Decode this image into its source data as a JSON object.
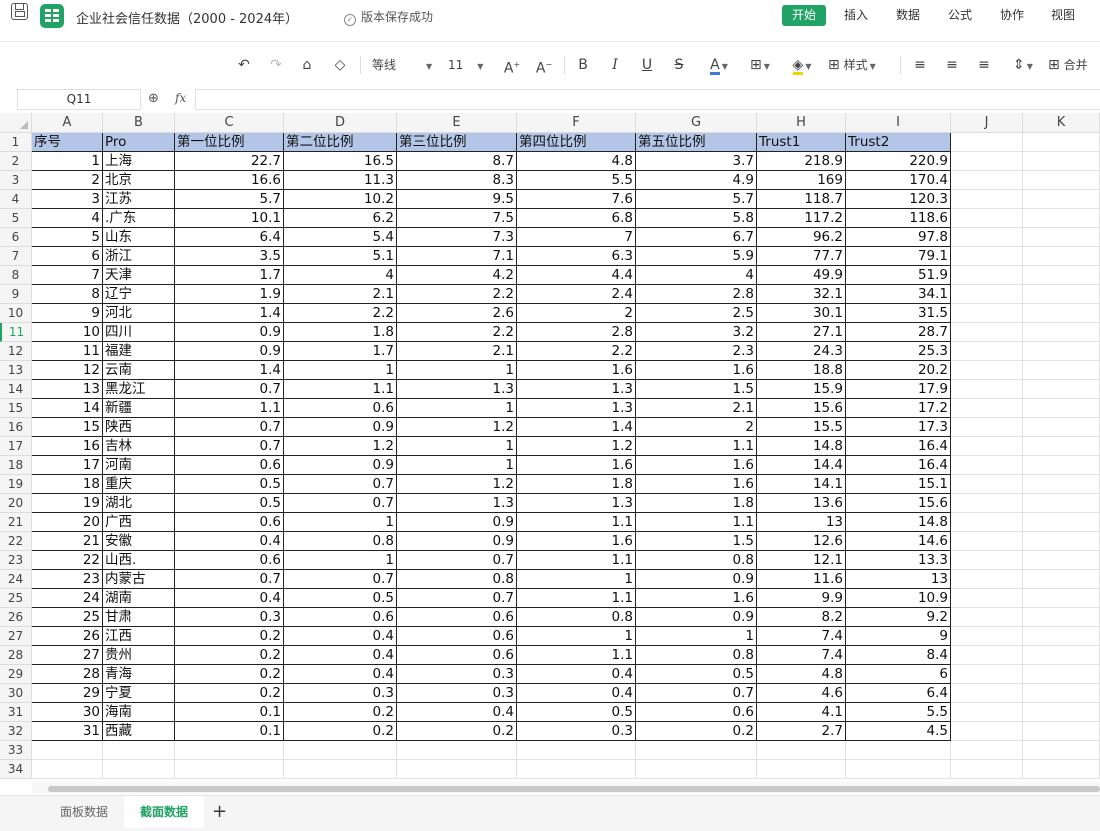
{
  "title": "企业社会信任数据（2000 - 2024年）",
  "save_status": "版本保存成功",
  "menu": [
    "开始",
    "插入",
    "数据",
    "公式",
    "协作",
    "视图"
  ],
  "toolbar": {
    "font_name": "等线",
    "font_size": "11",
    "style_label": "样式",
    "merge_label": "合并"
  },
  "name_box": "Q11",
  "fx_label": "fx",
  "columns": [
    "A",
    "B",
    "C",
    "D",
    "E",
    "F",
    "G",
    "H",
    "I",
    "J",
    "K"
  ],
  "selected_row": 11,
  "row_numbers": [
    1,
    2,
    3,
    4,
    5,
    6,
    7,
    8,
    9,
    10,
    11,
    12,
    13,
    14,
    15,
    16,
    17,
    18,
    19,
    20,
    21,
    22,
    23,
    24,
    25,
    26,
    27,
    28,
    29,
    30,
    31,
    32,
    33,
    34
  ],
  "headers": [
    "序号",
    "Pro",
    "第一位比例",
    "第二位比例",
    "第三位比例",
    "第四位比例",
    "第五位比例",
    "Trust1",
    "Trust2"
  ],
  "rows": [
    [
      "1",
      "上海",
      "22.7",
      "16.5",
      "8.7",
      "4.8",
      "3.7",
      "218.9",
      "220.9"
    ],
    [
      "2",
      "北京",
      "16.6",
      "11.3",
      "8.3",
      "5.5",
      "4.9",
      "169",
      "170.4"
    ],
    [
      "3",
      "江苏",
      "5.7",
      "10.2",
      "9.5",
      "7.6",
      "5.7",
      "118.7",
      "120.3"
    ],
    [
      "4",
      ".广东",
      "10.1",
      "6.2",
      "7.5",
      "6.8",
      "5.8",
      "117.2",
      "118.6"
    ],
    [
      "5",
      "山东",
      "6.4",
      "5.4",
      "7.3",
      "7",
      "6.7",
      "96.2",
      "97.8"
    ],
    [
      "6",
      "浙江",
      "3.5",
      "5.1",
      "7.1",
      "6.3",
      "5.9",
      "77.7",
      "79.1"
    ],
    [
      "7",
      "天津",
      "1.7",
      "4",
      "4.2",
      "4.4",
      "4",
      "49.9",
      "51.9"
    ],
    [
      "8",
      "辽宁",
      "1.9",
      "2.1",
      "2.2",
      "2.4",
      "2.8",
      "32.1",
      "34.1"
    ],
    [
      "9",
      "河北",
      "1.4",
      "2.2",
      "2.6",
      "2",
      "2.5",
      "30.1",
      "31.5"
    ],
    [
      "10",
      "四川",
      "0.9",
      "1.8",
      "2.2",
      "2.8",
      "3.2",
      "27.1",
      "28.7"
    ],
    [
      "11",
      "福建",
      "0.9",
      "1.7",
      "2.1",
      "2.2",
      "2.3",
      "24.3",
      "25.3"
    ],
    [
      "12",
      "云南",
      "1.4",
      "1",
      "1",
      "1.6",
      "1.6",
      "18.8",
      "20.2"
    ],
    [
      "13",
      "黑龙江",
      "0.7",
      "1.1",
      "1.3",
      "1.3",
      "1.5",
      "15.9",
      "17.9"
    ],
    [
      "14",
      "新疆",
      "1.1",
      "0.6",
      "1",
      "1.3",
      "2.1",
      "15.6",
      "17.2"
    ],
    [
      "15",
      "陕西",
      "0.7",
      "0.9",
      "1.2",
      "1.4",
      "2",
      "15.5",
      "17.3"
    ],
    [
      "16",
      "吉林",
      "0.7",
      "1.2",
      "1",
      "1.2",
      "1.1",
      "14.8",
      "16.4"
    ],
    [
      "17",
      "河南",
      "0.6",
      "0.9",
      "1",
      "1.6",
      "1.6",
      "14.4",
      "16.4"
    ],
    [
      "18",
      "重庆",
      "0.5",
      "0.7",
      "1.2",
      "1.8",
      "1.6",
      "14.1",
      "15.1"
    ],
    [
      "19",
      "湖北",
      "0.5",
      "0.7",
      "1.3",
      "1.3",
      "1.8",
      "13.6",
      "15.6"
    ],
    [
      "20",
      "广西",
      "0.6",
      "1",
      "0.9",
      "1.1",
      "1.1",
      "13",
      "14.8"
    ],
    [
      "21",
      "安徽",
      "0.4",
      "0.8",
      "0.9",
      "1.6",
      "1.5",
      "12.6",
      "14.6"
    ],
    [
      "22",
      "山西.",
      "0.6",
      "1",
      "0.7",
      "1.1",
      "0.8",
      "12.1",
      "13.3"
    ],
    [
      "23",
      "内蒙古",
      "0.7",
      "0.7",
      "0.8",
      "1",
      "0.9",
      "11.6",
      "13"
    ],
    [
      "24",
      "湖南",
      "0.4",
      "0.5",
      "0.7",
      "1.1",
      "1.6",
      "9.9",
      "10.9"
    ],
    [
      "25",
      "甘肃",
      "0.3",
      "0.6",
      "0.6",
      "0.8",
      "0.9",
      "8.2",
      "9.2"
    ],
    [
      "26",
      "江西",
      "0.2",
      "0.4",
      "0.6",
      "1",
      "1",
      "7.4",
      "9"
    ],
    [
      "27",
      "贵州",
      "0.2",
      "0.4",
      "0.6",
      "1.1",
      "0.8",
      "7.4",
      "8.4"
    ],
    [
      "28",
      "青海",
      "0.2",
      "0.4",
      "0.3",
      "0.4",
      "0.5",
      "4.8",
      "6"
    ],
    [
      "29",
      "宁夏",
      "0.2",
      "0.3",
      "0.3",
      "0.4",
      "0.7",
      "4.6",
      "6.4"
    ],
    [
      "30",
      "海南",
      "0.1",
      "0.2",
      "0.4",
      "0.5",
      "0.6",
      "4.1",
      "5.5"
    ],
    [
      "31",
      "西藏",
      "0.1",
      "0.2",
      "0.2",
      "0.3",
      "0.2",
      "2.7",
      "4.5"
    ]
  ],
  "sheets": [
    "面板数据",
    "截面数据"
  ],
  "active_sheet": 1,
  "colors": {
    "accent": "#21a366",
    "header_fill": "#b4c6e7"
  }
}
